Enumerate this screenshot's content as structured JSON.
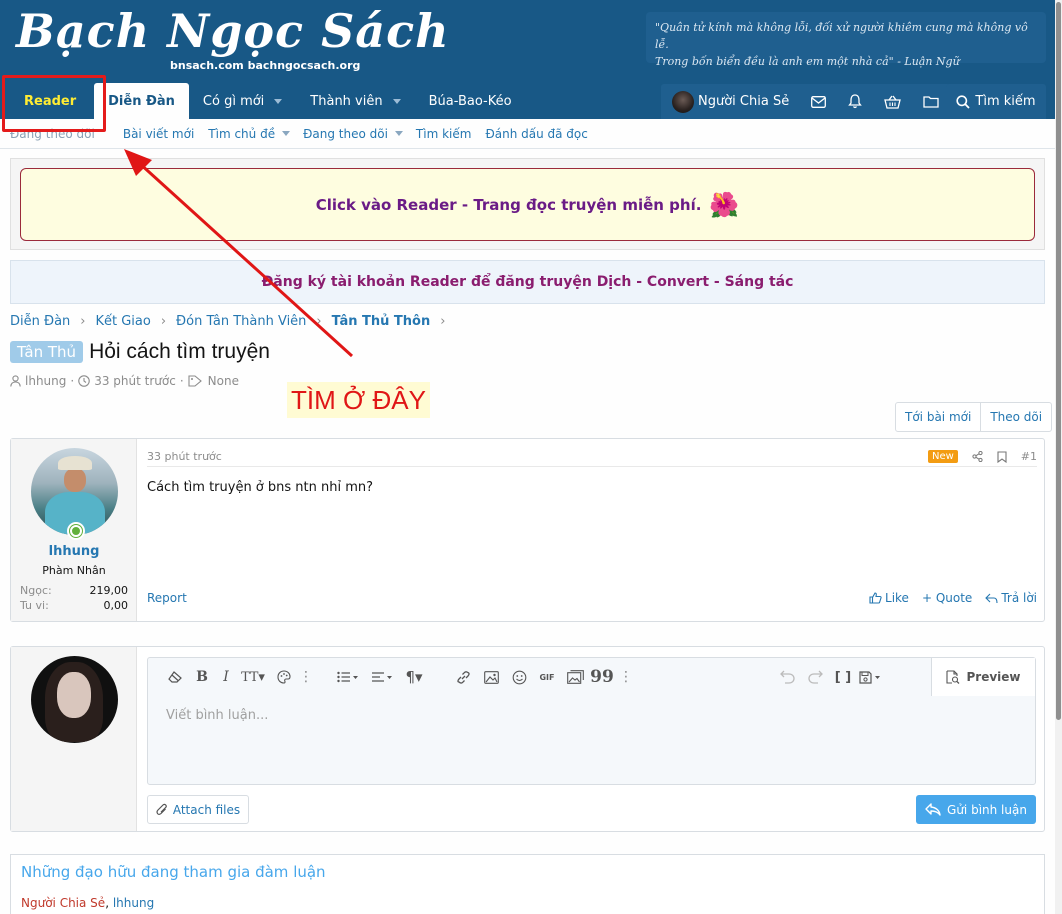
{
  "brand": {
    "logo_text": "Bạch Ngọc Sách",
    "logo_sub": "bnsach.com bachngocsach.org",
    "quote_line1": "\"Quân tử kính mà không lỗi, đối xử người khiêm cung mà không vô lễ.",
    "quote_line2": "Trong bốn biển đều là anh em một nhà cả\" - Luận Ngữ"
  },
  "nav": {
    "tabs": [
      {
        "label": "Reader"
      },
      {
        "label": "Diễn Đàn"
      },
      {
        "label": "Có gì mới"
      },
      {
        "label": "Thành viên"
      },
      {
        "label": "Búa-Bao-Kéo"
      }
    ],
    "user_label": "Người Chia Sẻ",
    "search_label": "Tìm kiếm"
  },
  "subnav": {
    "items": [
      {
        "label": "Đang theo dõi"
      },
      {
        "label": "Bài viết mới"
      },
      {
        "label": "Tìm chủ đề"
      },
      {
        "label": "Đang theo dõi"
      },
      {
        "label": "Tìm kiếm"
      },
      {
        "label": "Đánh dấu đã đọc"
      }
    ]
  },
  "notices": {
    "reader": "Click vào Reader - Trang đọc truyện miễn phí.",
    "flower": "🌺",
    "register": "Đăng ký tài khoản Reader để đăng truyện Dịch - Convert - Sáng tác"
  },
  "breadcrumb": [
    "Diễn Đàn",
    "Kết Giao",
    "Đón Tân Thành Viên",
    "Tân Thủ Thôn"
  ],
  "breadcrumb_sep": "›",
  "thread": {
    "prefix": "Tân Thủ",
    "title": "Hỏi cách tìm truyện",
    "author": "lhhung",
    "sep": "·",
    "time": "33 phút trước",
    "tags": "None"
  },
  "annotation": "TÌM Ở ĐÂY",
  "thread_buttons": {
    "newest": "Tới bài mới",
    "follow": "Theo dõi"
  },
  "post": {
    "username": "lhhung",
    "user_title": "Phàm Nhân",
    "stats": [
      {
        "key": "Ngọc:",
        "value": "219,00"
      },
      {
        "key": "Tu vi:",
        "value": "0,00"
      }
    ],
    "time": "33 phút trước",
    "badge": "New",
    "number": "#1",
    "body": "Cách tìm truyện ở bns ntn nhỉ mn?",
    "report": "Report",
    "like": "Like",
    "quote": "+ Quote",
    "reply": "Trả lời"
  },
  "reply": {
    "placeholder": "Viết bình luận...",
    "preview": "Preview",
    "attach": "Attach files",
    "submit": "Gửi bình luận",
    "toolbar_tt": "T",
    "toolbar_gif": "GIF",
    "toolbar_quote": "99"
  },
  "participants": {
    "heading": "Những đạo hữu đang tham gia đàm luận",
    "member1": "Người Chia Sẻ",
    "separator": ", ",
    "member2": "lhhung"
  },
  "colors": {
    "header": "#185886",
    "reader_tab": "#ffec33",
    "annotation_red": "#e01616",
    "accent": "#47a7eb"
  }
}
